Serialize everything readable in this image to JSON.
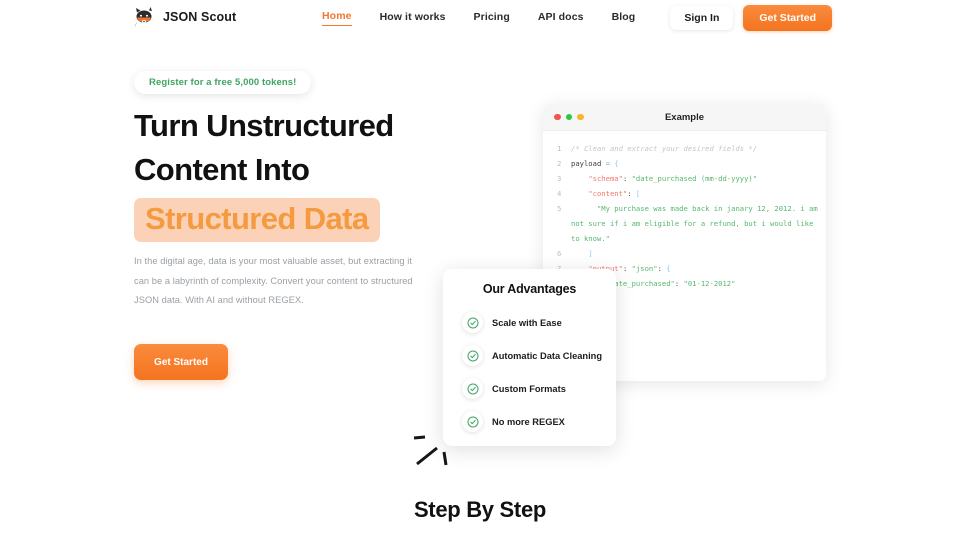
{
  "header": {
    "brand": {
      "name": "JSON Scout",
      "logo_icon": "fox-mascot-sunglasses-icon"
    },
    "nav": [
      {
        "label": "Home",
        "active": true
      },
      {
        "label": "How it works",
        "active": false
      },
      {
        "label": "Pricing",
        "active": false
      },
      {
        "label": "API docs",
        "active": false
      },
      {
        "label": "Blog",
        "active": false
      }
    ],
    "sign_in_label": "Sign In",
    "get_started_label": "Get Started"
  },
  "hero": {
    "badge": "Register for a free 5,000 tokens!",
    "headline_line1": "Turn Unstructured",
    "headline_line2": "Content Into",
    "headline_highlight": "Structured Data",
    "paragraph": "In the digital age, data is your most valuable asset, but extracting it can be a labyrinth of complexity. Convert your content to structured JSON data. With AI and without REGEX.",
    "cta_label": "Get Started"
  },
  "code_panel": {
    "title": "Example",
    "window_dots": [
      "red",
      "green",
      "yellow"
    ],
    "lines": [
      {
        "num": "1",
        "tokens": [
          {
            "t": "/* Clean and extract your desired fields */",
            "c": "c-comment"
          }
        ]
      },
      {
        "num": "2",
        "tokens": [
          {
            "t": "payload ",
            "c": "c-plain"
          },
          {
            "t": "= ",
            "c": "c-op"
          },
          {
            "t": "{",
            "c": "c-punc"
          }
        ]
      },
      {
        "num": "3",
        "tokens": [
          {
            "t": "    ",
            "c": "c-plain"
          },
          {
            "t": "\"schema\"",
            "c": "c-key"
          },
          {
            "t": ": ",
            "c": "c-plain"
          },
          {
            "t": "\"date_purchased (mm-dd-yyyy)\"",
            "c": "c-str"
          }
        ]
      },
      {
        "num": "4",
        "tokens": [
          {
            "t": "    ",
            "c": "c-plain"
          },
          {
            "t": "\"content\"",
            "c": "c-key"
          },
          {
            "t": ": ",
            "c": "c-plain"
          },
          {
            "t": "[",
            "c": "c-punc"
          }
        ]
      },
      {
        "num": "5",
        "tokens": [
          {
            "t": "      ",
            "c": "c-plain"
          },
          {
            "t": "\"My purchase was made back in janary 12, 2012. i am not sure if i am eligible for a refund, but i would like to know.\"",
            "c": "c-str"
          }
        ]
      },
      {
        "num": "6",
        "tokens": [
          {
            "t": "    ",
            "c": "c-plain"
          },
          {
            "t": "]",
            "c": "c-punc"
          }
        ]
      },
      {
        "num": "7",
        "tokens": [
          {
            "t": "    ",
            "c": "c-plain"
          },
          {
            "t": "\"output\"",
            "c": "c-key"
          },
          {
            "t": ": ",
            "c": "c-plain"
          },
          {
            "t": "\"json\"",
            "c": "c-str"
          },
          {
            "t": ": ",
            "c": "c-plain"
          },
          {
            "t": "{",
            "c": "c-punc"
          }
        ]
      },
      {
        "num": "",
        "tokens": [
          {
            "t": "        ",
            "c": "c-plain"
          },
          {
            "t": "\"date_purchased\"",
            "c": "c-str"
          },
          {
            "t": ": ",
            "c": "c-plain"
          },
          {
            "t": "\"01-12-2012\"",
            "c": "c-str"
          }
        ]
      }
    ]
  },
  "advantages": {
    "title": "Our Advantages",
    "items": [
      {
        "label": "Scale with Ease",
        "icon": "check-circle-icon"
      },
      {
        "label": "Automatic Data Cleaning",
        "icon": "check-circle-icon"
      },
      {
        "label": "Custom Formats",
        "icon": "check-circle-icon"
      },
      {
        "label": "No more REGEX",
        "icon": "check-circle-icon"
      }
    ]
  },
  "section": {
    "step_heading": "Step By Step"
  },
  "colors": {
    "accent_orange": "#F2762E",
    "highlight_bg": "#FBD2B7",
    "highlight_text": "#F59A3F",
    "badge_green": "#3FA563",
    "check_green": "#3FA563",
    "body_gray": "#9AA0A6",
    "heading_black": "#111111"
  }
}
